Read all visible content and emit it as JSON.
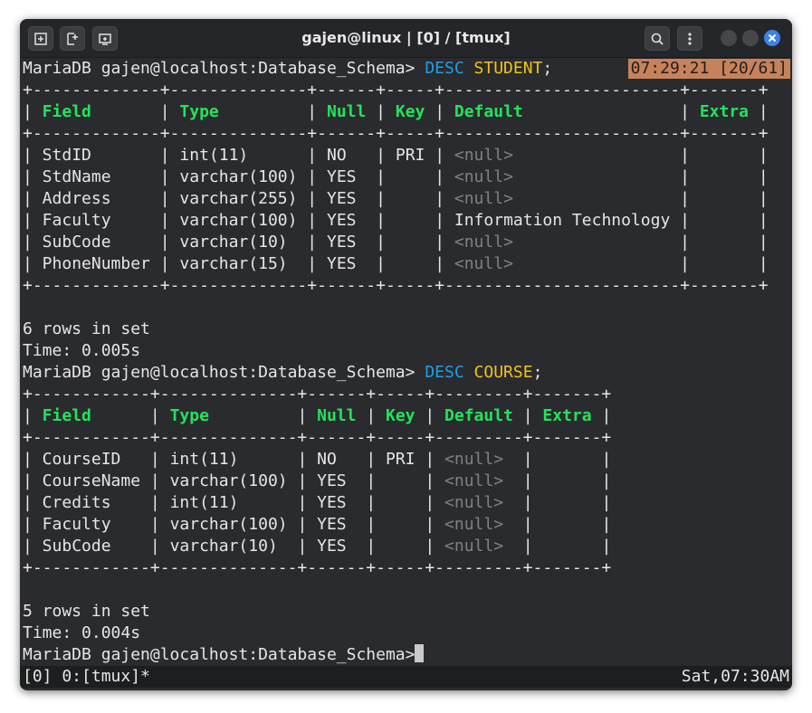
{
  "window": {
    "title": "gajen@linux | [0] / [tmux]",
    "buttons": [
      "new-tab",
      "split",
      "attach"
    ],
    "controls": {
      "search": "search-icon",
      "menu": "kebab-menu-icon",
      "close": "close-icon"
    }
  },
  "colors": {
    "background": "#2a2b2e",
    "keyword": "#1e9ee8",
    "table_name": "#f2c21b",
    "header": "#23e35b",
    "null": "#7f8084",
    "clock_bg": "#c8825a",
    "close_button": "#3c83e6"
  },
  "clock": "07:29:21 [20/61]",
  "session1": {
    "prompt": "MariaDB gajen@localhost:Database_Schema> ",
    "keyword": "DESC",
    "table": "STUDENT",
    "end": ";",
    "border": "+-------------+--------------+------+-----+------------------------+-------+",
    "headers": [
      "Field",
      "Type",
      "Null",
      "Key",
      "Default",
      "Extra"
    ],
    "rows": [
      {
        "field": "StdID",
        "type": "int(11)",
        "null": "NO",
        "key": "PRI",
        "default": "<null>",
        "is_null": true,
        "extra": ""
      },
      {
        "field": "StdName",
        "type": "varchar(100)",
        "null": "YES",
        "key": "",
        "default": "<null>",
        "is_null": true,
        "extra": ""
      },
      {
        "field": "Address",
        "type": "varchar(255)",
        "null": "YES",
        "key": "",
        "default": "<null>",
        "is_null": true,
        "extra": ""
      },
      {
        "field": "Faculty",
        "type": "varchar(100)",
        "null": "YES",
        "key": "",
        "default": "Information Technology",
        "is_null": false,
        "extra": ""
      },
      {
        "field": "SubCode",
        "type": "varchar(10)",
        "null": "YES",
        "key": "",
        "default": "<null>",
        "is_null": true,
        "extra": ""
      },
      {
        "field": "PhoneNumber",
        "type": "varchar(15)",
        "null": "YES",
        "key": "",
        "default": "<null>",
        "is_null": true,
        "extra": ""
      }
    ],
    "rows_in_set": "6 rows in set",
    "time": "Time: 0.005s"
  },
  "session2": {
    "prompt": "MariaDB gajen@localhost:Database_Schema> ",
    "keyword": "DESC",
    "table": "COURSE",
    "end": ";",
    "border": "+------------+--------------+------+-----+---------+-------+",
    "headers": [
      "Field",
      "Type",
      "Null",
      "Key",
      "Default",
      "Extra"
    ],
    "rows": [
      {
        "field": "CourseID",
        "type": "int(11)",
        "null": "NO",
        "key": "PRI",
        "default": "<null>",
        "is_null": true,
        "extra": ""
      },
      {
        "field": "CourseName",
        "type": "varchar(100)",
        "null": "YES",
        "key": "",
        "default": "<null>",
        "is_null": true,
        "extra": ""
      },
      {
        "field": "Credits",
        "type": "int(11)",
        "null": "YES",
        "key": "",
        "default": "<null>",
        "is_null": true,
        "extra": ""
      },
      {
        "field": "Faculty",
        "type": "varchar(100)",
        "null": "YES",
        "key": "",
        "default": "<null>",
        "is_null": true,
        "extra": ""
      },
      {
        "field": "SubCode",
        "type": "varchar(10)",
        "null": "YES",
        "key": "",
        "default": "<null>",
        "is_null": true,
        "extra": ""
      }
    ],
    "rows_in_set": "5 rows in set",
    "time": "Time: 0.004s"
  },
  "final_prompt": "MariaDB gajen@localhost:Database_Schema>",
  "status": {
    "left": "[0] 0:[tmux]*",
    "right": "Sat,07:30AM"
  }
}
